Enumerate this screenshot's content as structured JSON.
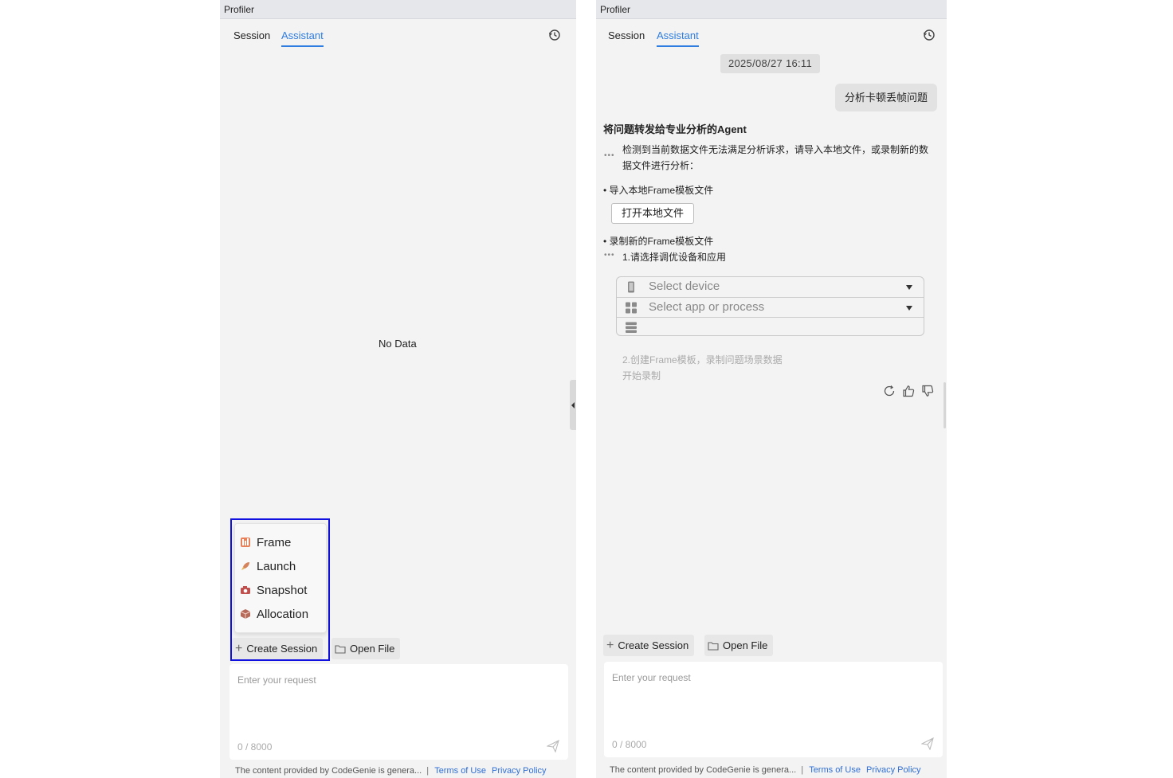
{
  "left": {
    "title": "Profiler",
    "tabs": [
      "Session",
      "Assistant"
    ],
    "active_tab": "Assistant",
    "empty_text": "No Data",
    "menu_items": [
      {
        "label": "Frame",
        "icon": "frame-icon",
        "color": "#e0633f"
      },
      {
        "label": "Launch",
        "icon": "rocket-icon",
        "color": "#d4835a"
      },
      {
        "label": "Snapshot",
        "icon": "camera-icon",
        "color": "#c0504d"
      },
      {
        "label": "Allocation",
        "icon": "box-icon",
        "color": "#b56a5a"
      }
    ],
    "create_session": "Create Session",
    "open_file": "Open File",
    "input_placeholder": "Enter your request",
    "counter": "0 / 8000",
    "footer_text": "The content provided by CodeGenie is genera...",
    "footer_sep": "|",
    "terms": "Terms of Use",
    "privacy": "Privacy Policy"
  },
  "right": {
    "title": "Profiler",
    "tabs": [
      "Session",
      "Assistant"
    ],
    "active_tab": "Assistant",
    "timestamp": "2025/08/27 16:11",
    "user_message": "分析卡顿丢帧问题",
    "agent_title": "将问题转发给专业分析的Agent",
    "agent_text": "检测到当前数据文件无法满足分析诉求，请导入本地文件，或录制新的数据文件进行分析：",
    "bullet_import": "• 导入本地Frame模板文件",
    "open_local_button": "打开本地文件",
    "bullet_record": "• 录制新的Frame模板文件",
    "step1": "1.请选择调优设备和应用",
    "select_device_placeholder": "Select device",
    "select_app_placeholder": "Select app or process",
    "step2_line1": "2.创建Frame模板，录制问题场景数据",
    "step2_line2": "开始录制",
    "create_session": "Create Session",
    "open_file": "Open File",
    "input_placeholder": "Enter your request",
    "counter": "0 / 8000",
    "footer_text": "The content provided by CodeGenie is genera...",
    "footer_sep": "|",
    "terms": "Terms of Use",
    "privacy": "Privacy Policy"
  },
  "colors": {
    "accent": "#2f7de1",
    "highlight_box": "#1010e0",
    "panel_bg": "#f3f3f3"
  }
}
